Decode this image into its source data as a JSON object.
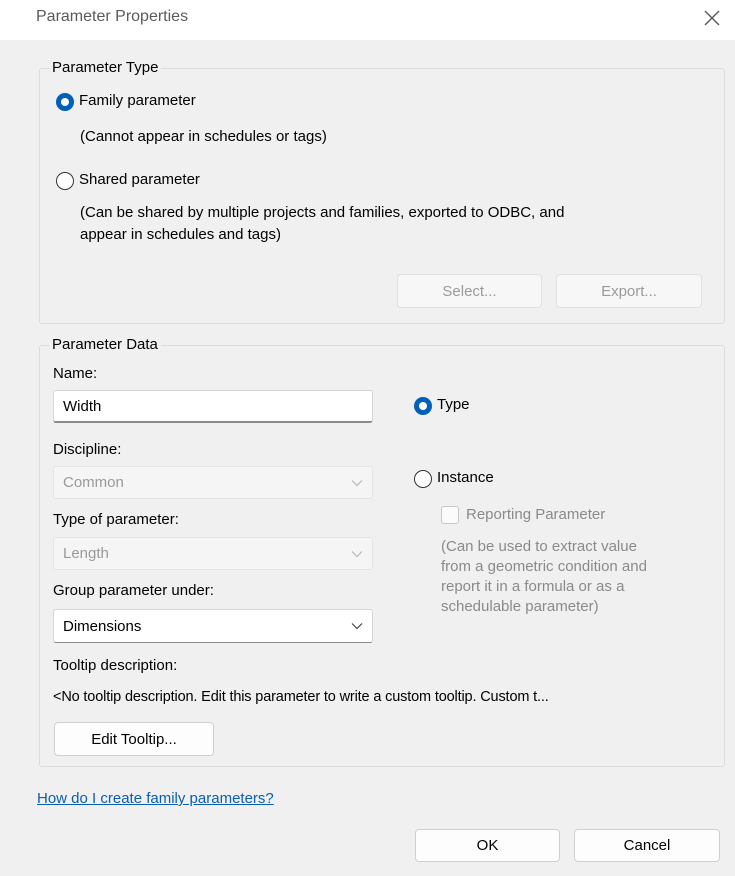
{
  "window": {
    "title": "Parameter Properties",
    "close_icon": "close-icon"
  },
  "parameter_type": {
    "legend": "Parameter Type",
    "family_label": "Family parameter",
    "family_note": "(Cannot appear in schedules or tags)",
    "shared_label": "Shared parameter",
    "shared_note_line1": "(Can be shared by multiple projects and families, exported to ODBC, and",
    "shared_note_line2": "appear in schedules and tags)",
    "select_button": "Select...",
    "export_button": "Export...",
    "selected": "family"
  },
  "parameter_data": {
    "legend": "Parameter Data",
    "name_label": "Name:",
    "name_value": "Width",
    "discipline_label": "Discipline:",
    "discipline_value": "Common",
    "type_label": "Type of parameter:",
    "type_value": "Length",
    "group_label": "Group parameter under:",
    "group_value": "Dimensions",
    "type_radio_label": "Type",
    "instance_radio_label": "Instance",
    "reporting_label": "Reporting Parameter",
    "reporting_note_line1": "(Can be used to extract value",
    "reporting_note_line2": "from a geometric condition and",
    "reporting_note_line3": "report it in a formula or as a",
    "reporting_note_line4": "schedulable parameter)",
    "tooltip_label": "Tooltip description:",
    "tooltip_value": "<No tooltip description. Edit this parameter to write a custom tooltip. Custom t...",
    "edit_tooltip_button": "Edit Tooltip...",
    "selected": "type"
  },
  "footer": {
    "help_link": "How do I create family parameters?",
    "ok_button": "OK",
    "cancel_button": "Cancel"
  },
  "colors": {
    "accent": "#005fb8",
    "link": "#0a5fb0",
    "background": "#f0f0f0"
  }
}
